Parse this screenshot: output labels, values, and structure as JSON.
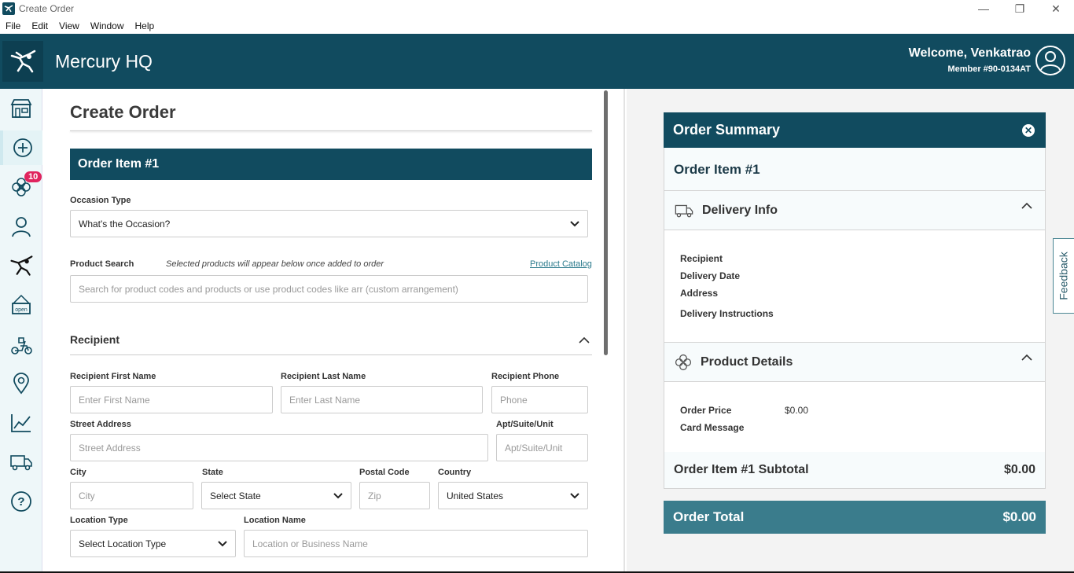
{
  "window": {
    "title": "Create Order"
  },
  "menu": [
    "File",
    "Edit",
    "View",
    "Window",
    "Help"
  ],
  "header": {
    "app_name": "Mercury HQ",
    "welcome": "Welcome, Venkatrao",
    "member": "Member #90-0134AT",
    "color": "#114b5f"
  },
  "nav": {
    "badge_count": "10",
    "items": [
      "shop-icon",
      "add-circle-icon",
      "flower-icon",
      "person-icon",
      "mercury-logo-icon",
      "open-sign-icon",
      "scooter-icon",
      "location-pin-icon",
      "chart-icon",
      "truck-icon",
      "help-icon"
    ]
  },
  "form": {
    "page_title": "Create Order",
    "item_title": "Order Item #1",
    "occasion_label": "Occasion Type",
    "occasion_value": "What's the Occasion?",
    "product_search_label": "Product Search",
    "product_search_note": "Selected products will appear below once added to order",
    "product_catalog_link": "Product Catalog",
    "product_search_placeholder": "Search for product codes and products or use product codes like arr (custom arrangement)",
    "recipient_title": "Recipient",
    "first_name_label": "Recipient First Name",
    "first_name_placeholder": "Enter First Name",
    "last_name_label": "Recipient Last Name",
    "last_name_placeholder": "Enter Last Name",
    "phone_label": "Recipient Phone",
    "phone_placeholder": "Phone",
    "street_label": "Street Address",
    "street_placeholder": "Street Address",
    "apt_label": "Apt/Suite/Unit",
    "apt_placeholder": "Apt/Suite/Unit",
    "city_label": "City",
    "city_placeholder": "City",
    "state_label": "State",
    "state_value": "Select State",
    "postal_label": "Postal Code",
    "postal_placeholder": "Zip",
    "country_label": "Country",
    "country_value": "United States",
    "location_type_label": "Location Type",
    "location_type_value": "Select Location Type",
    "location_name_label": "Location Name",
    "location_name_placeholder": "Location or Business Name"
  },
  "summary": {
    "title": "Order Summary",
    "item_title": "Order Item #1",
    "delivery_title": "Delivery Info",
    "delivery_fields": [
      "Recipient",
      "Delivery Date",
      "Address",
      "Delivery Instructions"
    ],
    "product_title": "Product Details",
    "order_price_label": "Order Price",
    "order_price_value": "$0.00",
    "card_message_label": "Card Message",
    "subtotal_label": "Order Item #1 Subtotal",
    "subtotal_value": "$0.00",
    "total_label": "Order Total",
    "total_value": "$0.00"
  },
  "feedback": "Feedback"
}
